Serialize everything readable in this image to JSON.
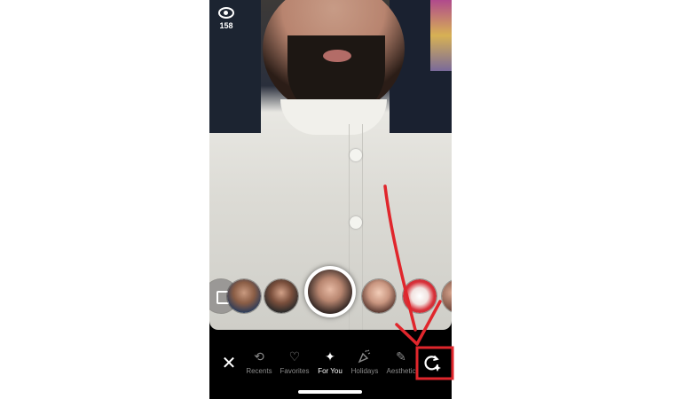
{
  "status": {
    "view_icon": "eye-icon",
    "view_count": "158"
  },
  "lens_carousel": {
    "items": [
      {
        "name": "lens-edit-button",
        "icon": "lens-edit-icon"
      },
      {
        "name": "lens-thumbnail-1"
      },
      {
        "name": "lens-thumbnail-2"
      },
      {
        "name": "lens-thumbnail-selected",
        "selected": true
      },
      {
        "name": "lens-thumbnail-4"
      },
      {
        "name": "lens-thumbnail-5"
      },
      {
        "name": "lens-thumbnail-6"
      }
    ]
  },
  "tabbar": {
    "close_icon": "close-icon",
    "close_glyph": "✕",
    "tabs": [
      {
        "label": "Recents",
        "icon": "history-icon",
        "glyph": "⟲",
        "active": false
      },
      {
        "label": "Favorites",
        "icon": "heart-icon",
        "glyph": "♡",
        "active": false
      },
      {
        "label": "For You",
        "icon": "sparkle-icon",
        "glyph": "✦",
        "active": true
      },
      {
        "label": "Holidays",
        "icon": "party-popper-icon",
        "glyph": "🎉",
        "active": false
      },
      {
        "label": "Aesthetic",
        "icon": "brush-icon",
        "glyph": "✎",
        "active": false
      }
    ],
    "discover_icon": "lens-discover-icon"
  },
  "colors": {
    "annotation_red": "#e0262c",
    "active_tab": "#ffffff",
    "inactive_tab": "#8b8b8b"
  }
}
